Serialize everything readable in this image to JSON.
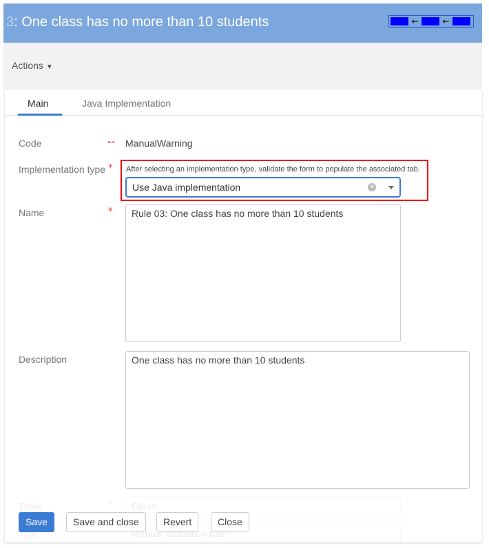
{
  "header": {
    "title_prefix": "3",
    "title": ": One class has no more than 10 students",
    "diagram_arrow": "←"
  },
  "toolbar": {
    "actions_label": "Actions"
  },
  "tabs": [
    {
      "label": "Main",
      "active": true
    },
    {
      "label": "Java Implementation",
      "active": false
    }
  ],
  "form": {
    "code": {
      "label": "Code",
      "value": "ManualWarning"
    },
    "implementation_type": {
      "label": "Implementation type",
      "required": "*",
      "hint": "After selecting an implementation type, validate the form to populate the associated tab.",
      "value": "Use Java implementation"
    },
    "name": {
      "label": "Name",
      "required": "*",
      "value": "Rule 03: One class has no more than 10 students"
    },
    "description": {
      "label": "Description",
      "value": "One class has no more than 10 students"
    },
    "table": {
      "label": "Table",
      "required": "*",
      "value": "Class"
    },
    "type": {
      "label": "Type",
      "required": "*",
      "value": "Manual validation rule"
    }
  },
  "buttons": {
    "save": "Save",
    "save_close": "Save and close",
    "revert": "Revert",
    "close": "Close"
  },
  "colors": {
    "header": "#7ba7de",
    "primary": "#3a7bd5",
    "highlight": "#e00000"
  }
}
